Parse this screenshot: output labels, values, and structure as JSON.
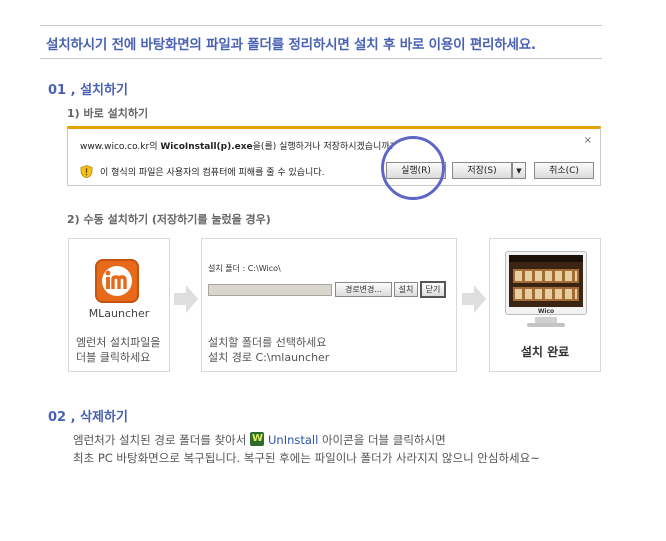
{
  "banner": "설치하시기 전에 바탕화면의 파일과 폴더를 정리하시면 설치 후 바로 이용이 편리하세요.",
  "section1": {
    "number": "01",
    "title": "설치하기",
    "step1": {
      "label": "1) 바로 설치하기",
      "ie_bar": {
        "question_prefix": "www.wico.co.kr의 ",
        "question_file": "WicoInstall(p).exe",
        "question_suffix": "을(를) 실행하거나 저장하시겠습니까?",
        "warning": "이 형식의 파일은 사용자의 컴퓨터에 피해를 줄 수 있습니다.",
        "run_button": "실행(R)",
        "save_button": "저장(S)",
        "cancel_button": "취소(C)",
        "close": "×"
      }
    },
    "step2": {
      "label": "2) 수동 설치하기 (저장하기를 눌렀을 경우)",
      "panel1": {
        "app_name": "MLauncher",
        "caption_line1": "엠런처 설치파일을",
        "caption_line2": "더블 클릭하세요"
      },
      "panel2": {
        "folder_label": "설치 폴더 : C:\\Wico\\",
        "change_button": "경로변경...",
        "install_button": "설치",
        "close_button": "닫기",
        "caption_line1": "설치할 폴더를 선택하세요",
        "caption_line2": "설치 경로 C:\\mlauncher"
      },
      "panel3": {
        "screen_title": "Wico",
        "caption": "설치 완료"
      }
    }
  },
  "section2": {
    "number": "02",
    "title": "삭제하기",
    "line1_before": "엠런처가 설치된  경로 폴더를 찾아서  ",
    "line1_app": "UnInstall",
    "line1_after": " 아이콘을 더블 클릭하시면",
    "line2": "최초 PC 바탕화면으로 복구됩니다. 복구된 후에는  파일이나 폴더가 사라지지 않으니 안심하세요~"
  },
  "colors": {
    "accent": "#4a62b4",
    "highlight_circle": "#5f66c8",
    "ie_bar_top": "#e3a100",
    "mlauncher_orange": "#e66a1a"
  }
}
